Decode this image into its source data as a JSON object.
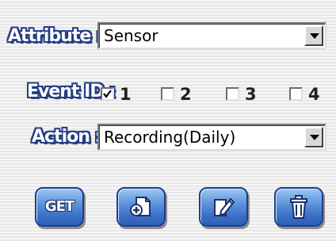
{
  "attribute": {
    "label": "Attribute :",
    "value": "Sensor"
  },
  "event_id": {
    "label": "Event ID :",
    "options": [
      {
        "label": "1",
        "checked": true
      },
      {
        "label": "2",
        "checked": false
      },
      {
        "label": "3",
        "checked": false
      },
      {
        "label": "4",
        "checked": false
      }
    ]
  },
  "action": {
    "label": "Action :",
    "value": "Recording(Daily)"
  },
  "buttons": {
    "get_label": "GET",
    "add_icon": "add-page-icon",
    "edit_icon": "edit-pencil-icon",
    "delete_icon": "trash-icon"
  },
  "colors": {
    "label_outline": "#233d84",
    "button_blue": "#3a6fc8"
  }
}
